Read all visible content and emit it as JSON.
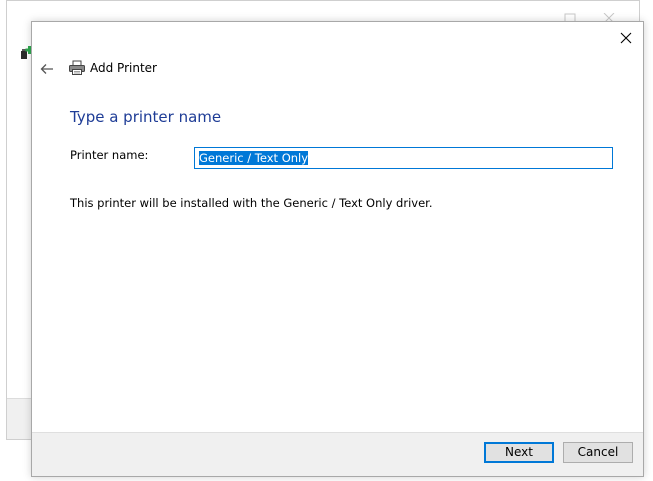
{
  "dialog": {
    "title": "Add Printer",
    "heading": "Type a printer name",
    "printer_name_label": "Printer name:",
    "printer_name_value": "Generic / Text Only",
    "info_text": "This printer will be installed with the Generic / Text Only driver."
  },
  "footer": {
    "next_label": "Next",
    "cancel_label": "Cancel"
  },
  "icons": {
    "close": "close-icon",
    "back": "back-arrow-icon",
    "title": "printer-icon",
    "background_app": "add-printer-app-icon"
  },
  "colors": {
    "accent": "#0078d7",
    "heading": "#1e3c96",
    "footer_bg": "#f0f0f0"
  }
}
